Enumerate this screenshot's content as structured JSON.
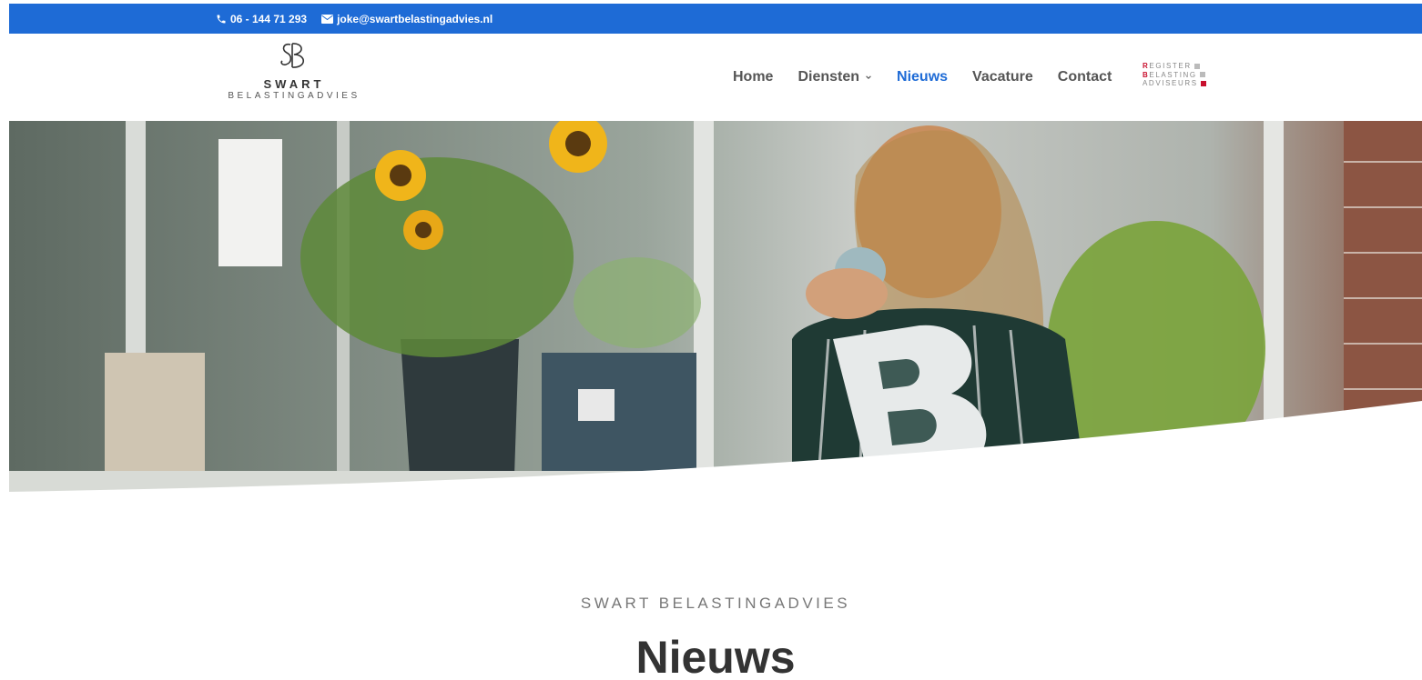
{
  "topbar": {
    "phone": "06 - 144 71 293",
    "email": "joke@swartbelastingadvies.nl",
    "phone_icon": "phone-icon",
    "email_icon": "envelope-icon"
  },
  "logo": {
    "monogram": "SB",
    "name": "SWART",
    "sub": "BELASTINGADVIES"
  },
  "nav": {
    "items": [
      {
        "label": "Home"
      },
      {
        "label": "Diensten"
      },
      {
        "label": "Nieuws"
      },
      {
        "label": "Vacature"
      },
      {
        "label": "Contact"
      }
    ],
    "active": "Nieuws"
  },
  "badge": {
    "line1_initial": "R",
    "line1_rest": "EGISTER",
    "line2_initial": "B",
    "line2_rest": "ELASTING",
    "line3": "ADVISEURS"
  },
  "section": {
    "eyebrow": "SWART BELASTINGADVIES",
    "title": "Nieuws"
  },
  "colors": {
    "accent": "#1e6bd6",
    "badge_red": "#c8102e",
    "text_dark": "#333333"
  }
}
